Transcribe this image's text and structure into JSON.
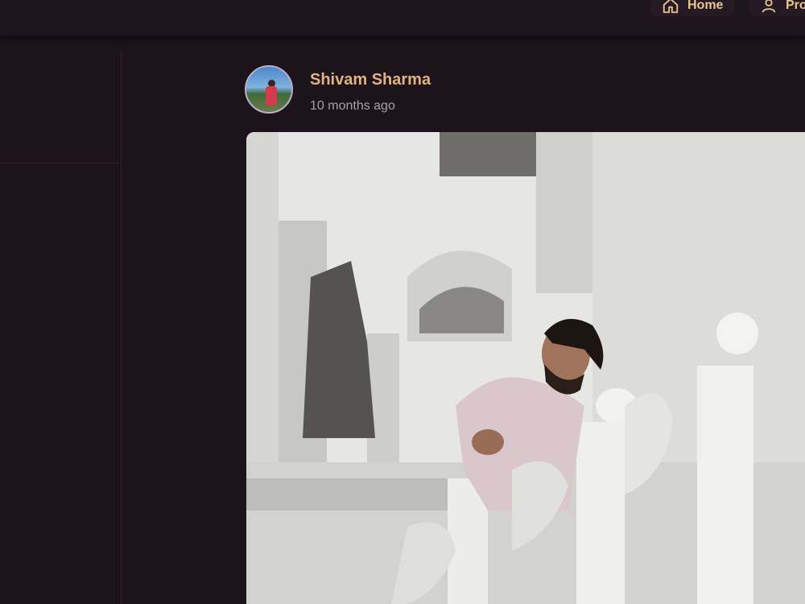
{
  "nav": {
    "home_label": "Home",
    "profile_label": "Profile"
  },
  "post": {
    "author_name": "Shivam Sharma",
    "timestamp": "10 months ago",
    "image_icon": "photo"
  },
  "colors": {
    "background": "#1d131b",
    "topbar": "#1f1520",
    "accent": "#e1b47e",
    "muted_text": "#a89fa8"
  }
}
